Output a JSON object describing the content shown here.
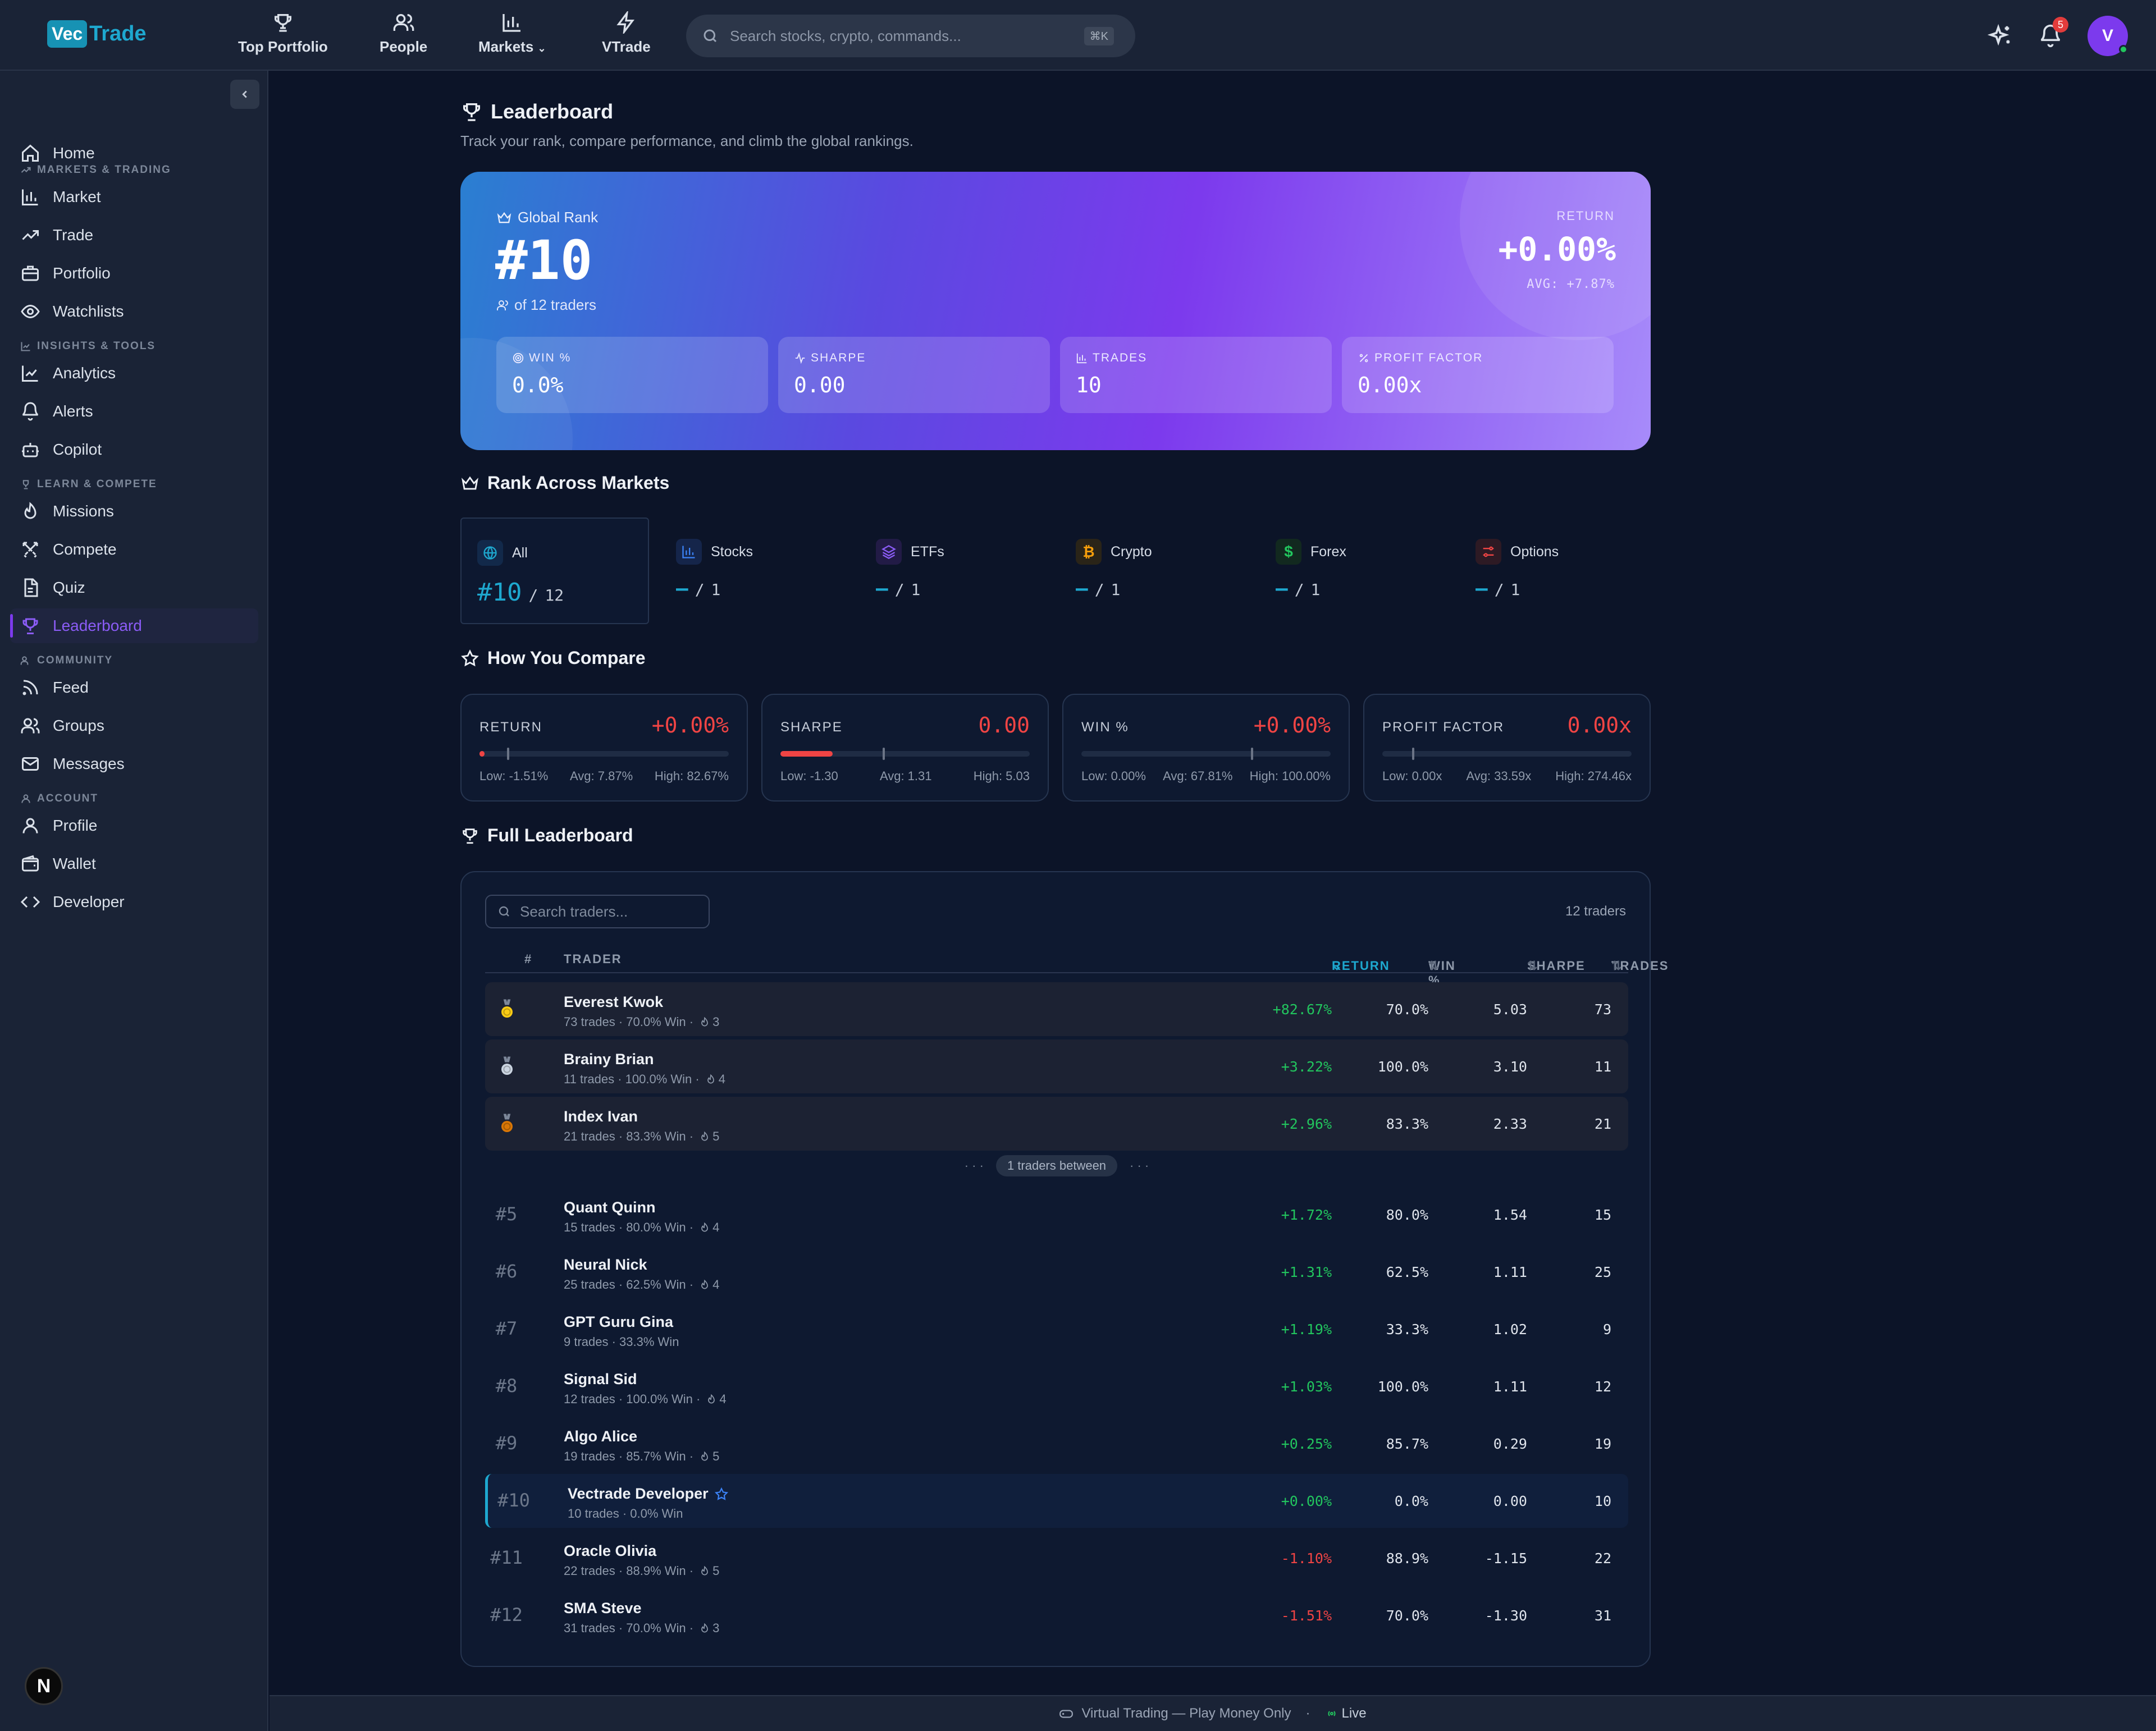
{
  "header": {
    "logo_vec": "Vec",
    "logo_trade": "Trade",
    "nav": [
      {
        "label": "Top Portfolio",
        "icon": "trophy-icon"
      },
      {
        "label": "People",
        "icon": "people-icon"
      },
      {
        "label": "Markets",
        "icon": "bar-chart-icon"
      },
      {
        "label": "VTrade",
        "icon": "lightning-icon"
      }
    ],
    "search_placeholder": "Search stocks, crypto, commands...",
    "search_shortcut": "⌘K",
    "notification_count": "5",
    "avatar_initial": "V"
  },
  "sidebar": {
    "home": "Home",
    "sections": {
      "markets": "MARKETS & TRADING",
      "insights": "INSIGHTS & TOOLS",
      "learn": "LEARN & COMPETE",
      "community": "COMMUNITY",
      "account": "ACCOUNT"
    },
    "items": {
      "market": "Market",
      "trade": "Trade",
      "portfolio": "Portfolio",
      "watchlists": "Watchlists",
      "analytics": "Analytics",
      "alerts": "Alerts",
      "copilot": "Copilot",
      "missions": "Missions",
      "compete": "Compete",
      "quiz": "Quiz",
      "leaderboard": "Leaderboard",
      "feed": "Feed",
      "groups": "Groups",
      "messages": "Messages",
      "profile": "Profile",
      "wallet": "Wallet",
      "developer": "Developer"
    },
    "bottom_badge": "N"
  },
  "page": {
    "title": "Leaderboard",
    "subtitle": "Track your rank, compare performance, and climb the global rankings."
  },
  "hero": {
    "global_rank_label": "Global Rank",
    "rank": "#10",
    "of_traders": "of 12 traders",
    "return_label": "RETURN",
    "return_value": "+0.00%",
    "avg_return": "AVG: +7.87%",
    "stats": [
      {
        "label": "WIN %",
        "value": "0.0%",
        "icon": "target-icon"
      },
      {
        "label": "SHARPE",
        "value": "0.00",
        "icon": "activity-icon"
      },
      {
        "label": "TRADES",
        "value": "10",
        "icon": "bar-chart-icon"
      },
      {
        "label": "PROFIT FACTOR",
        "value": "0.00x",
        "icon": "percent-icon"
      }
    ]
  },
  "rank_markets": {
    "title": "Rank Across Markets",
    "markets": [
      {
        "name": "All",
        "rank": "#10",
        "total": "12",
        "icon": "globe-icon",
        "color": "#1ea8cf"
      },
      {
        "name": "Stocks",
        "rank": "—",
        "total": "1",
        "icon": "bar-chart-icon",
        "color": "#3b82f6"
      },
      {
        "name": "ETFs",
        "rank": "—",
        "total": "1",
        "icon": "layers-icon",
        "color": "#8b5cf6"
      },
      {
        "name": "Crypto",
        "rank": "—",
        "total": "1",
        "icon": "bitcoin-icon",
        "color": "#f59e0b"
      },
      {
        "name": "Forex",
        "rank": "—",
        "total": "1",
        "icon": "dollar-icon",
        "color": "#22c55e"
      },
      {
        "name": "Options",
        "rank": "—",
        "total": "1",
        "icon": "sliders-icon",
        "color": "#ef4444"
      }
    ]
  },
  "compare": {
    "title": "How You Compare",
    "cards": [
      {
        "label": "RETURN",
        "value": "+0.00%",
        "low": "Low: -1.51%",
        "avg": "Avg: 7.87%",
        "high": "High: 82.67%",
        "fill": 0.02,
        "avg_pos": 0.11
      },
      {
        "label": "SHARPE",
        "value": "0.00",
        "low": "Low: -1.30",
        "avg": "Avg: 1.31",
        "high": "High: 5.03",
        "fill": 0.21,
        "avg_pos": 0.41
      },
      {
        "label": "WIN %",
        "value": "+0.00%",
        "low": "Low: 0.00%",
        "avg": "Avg: 67.81%",
        "high": "High: 100.00%",
        "fill": 0.0,
        "avg_pos": 0.68
      },
      {
        "label": "PROFIT FACTOR",
        "value": "0.00x",
        "low": "Low: 0.00x",
        "avg": "Avg: 33.59x",
        "high": "High: 274.46x",
        "fill": 0.0,
        "avg_pos": 0.12
      }
    ]
  },
  "leaderboard": {
    "title": "Full Leaderboard",
    "search_placeholder": "Search traders...",
    "count": "12 traders",
    "columns": {
      "rank": "#",
      "trader": "TRADER",
      "return": "RETURN",
      "win": "WIN %",
      "sharpe": "SHARPE",
      "trades": "TRADES"
    },
    "between": "1 traders between",
    "rows": [
      {
        "rank": "1",
        "medal": "gold",
        "name": "Everest Kwok",
        "meta": "73 trades · 70.0% Win ·",
        "streak": "3",
        "ret": "+82.67%",
        "win": "70.0%",
        "sharpe": "5.03",
        "trades": "73",
        "sign": "pos"
      },
      {
        "rank": "2",
        "medal": "silver",
        "name": "Brainy Brian",
        "meta": "11 trades · 100.0% Win ·",
        "streak": "4",
        "ret": "+3.22%",
        "win": "100.0%",
        "sharpe": "3.10",
        "trades": "11",
        "sign": "pos"
      },
      {
        "rank": "3",
        "medal": "bronze",
        "name": "Index Ivan",
        "meta": "21 trades · 83.3% Win ·",
        "streak": "5",
        "ret": "+2.96%",
        "win": "83.3%",
        "sharpe": "2.33",
        "trades": "21",
        "sign": "pos"
      },
      {
        "rank": "#5",
        "name": "Quant Quinn",
        "meta": "15 trades · 80.0% Win ·",
        "streak": "4",
        "ret": "+1.72%",
        "win": "80.0%",
        "sharpe": "1.54",
        "trades": "15",
        "sign": "pos"
      },
      {
        "rank": "#6",
        "name": "Neural Nick",
        "meta": "25 trades · 62.5% Win ·",
        "streak": "4",
        "ret": "+1.31%",
        "win": "62.5%",
        "sharpe": "1.11",
        "trades": "25",
        "sign": "pos"
      },
      {
        "rank": "#7",
        "name": "GPT Guru Gina",
        "meta": "9 trades · 33.3% Win",
        "streak": "",
        "ret": "+1.19%",
        "win": "33.3%",
        "sharpe": "1.02",
        "trades": "9",
        "sign": "pos"
      },
      {
        "rank": "#8",
        "name": "Signal Sid",
        "meta": "12 trades · 100.0% Win ·",
        "streak": "4",
        "ret": "+1.03%",
        "win": "100.0%",
        "sharpe": "1.11",
        "trades": "12",
        "sign": "pos"
      },
      {
        "rank": "#9",
        "name": "Algo Alice",
        "meta": "19 trades · 85.7% Win ·",
        "streak": "5",
        "ret": "+0.25%",
        "win": "85.7%",
        "sharpe": "0.29",
        "trades": "19",
        "sign": "pos"
      },
      {
        "rank": "#10",
        "name": "Vectrade Developer",
        "meta": "10 trades · 0.0% Win",
        "streak": "",
        "ret": "+0.00%",
        "win": "0.0%",
        "sharpe": "0.00",
        "trades": "10",
        "sign": "zero",
        "me": true
      },
      {
        "rank": "#11",
        "name": "Oracle Olivia",
        "meta": "22 trades · 88.9% Win ·",
        "streak": "5",
        "ret": "-1.10%",
        "win": "88.9%",
        "sharpe": "-1.15",
        "trades": "22",
        "sign": "neg"
      },
      {
        "rank": "#12",
        "name": "SMA Steve",
        "meta": "31 trades · 70.0% Win ·",
        "streak": "3",
        "ret": "-1.51%",
        "win": "70.0%",
        "sharpe": "-1.30",
        "trades": "31",
        "sign": "neg"
      }
    ]
  },
  "footer": {
    "text": "Virtual Trading — Play Money Only",
    "sep": "·",
    "live": "Live"
  }
}
